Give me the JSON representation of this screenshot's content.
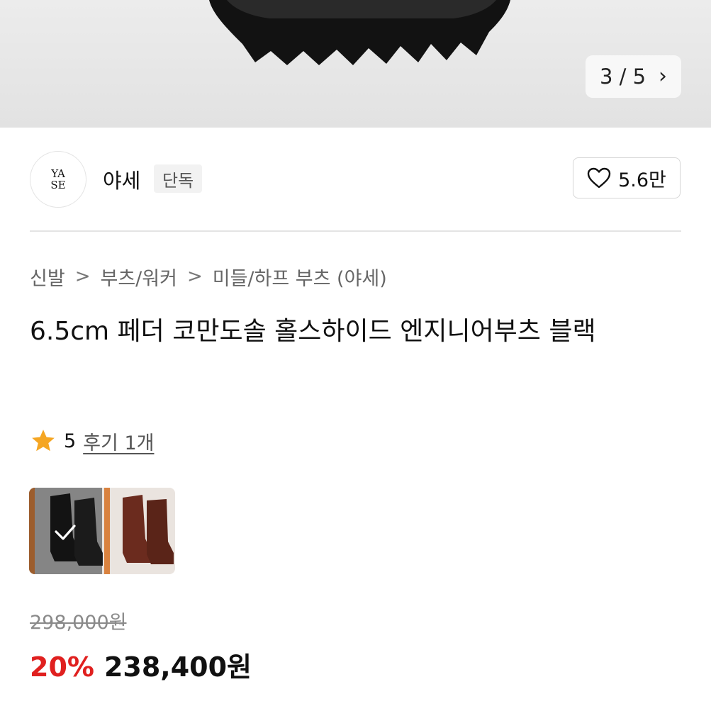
{
  "hero": {
    "pager": {
      "current": "3 / 5",
      "next_icon": "chevron-right-icon"
    }
  },
  "store": {
    "name": "야세",
    "badge": "단독",
    "likes": "5.6만",
    "like_icon": "heart-icon"
  },
  "breadcrumb": {
    "items": [
      "신발",
      "부츠/워커",
      "미들/하프 부츠 (야세)"
    ],
    "separator": ">"
  },
  "product": {
    "title": "6.5cm 페더 코만도솔 홀스하이드 엔지니어부츠 블랙",
    "rating": "5",
    "reviews": "후기 1개",
    "original_price": "298,000원",
    "discount": "20%",
    "sale_price": "238,400원"
  },
  "colors": {
    "discount": "#e0201f",
    "star": "#f5a623"
  }
}
